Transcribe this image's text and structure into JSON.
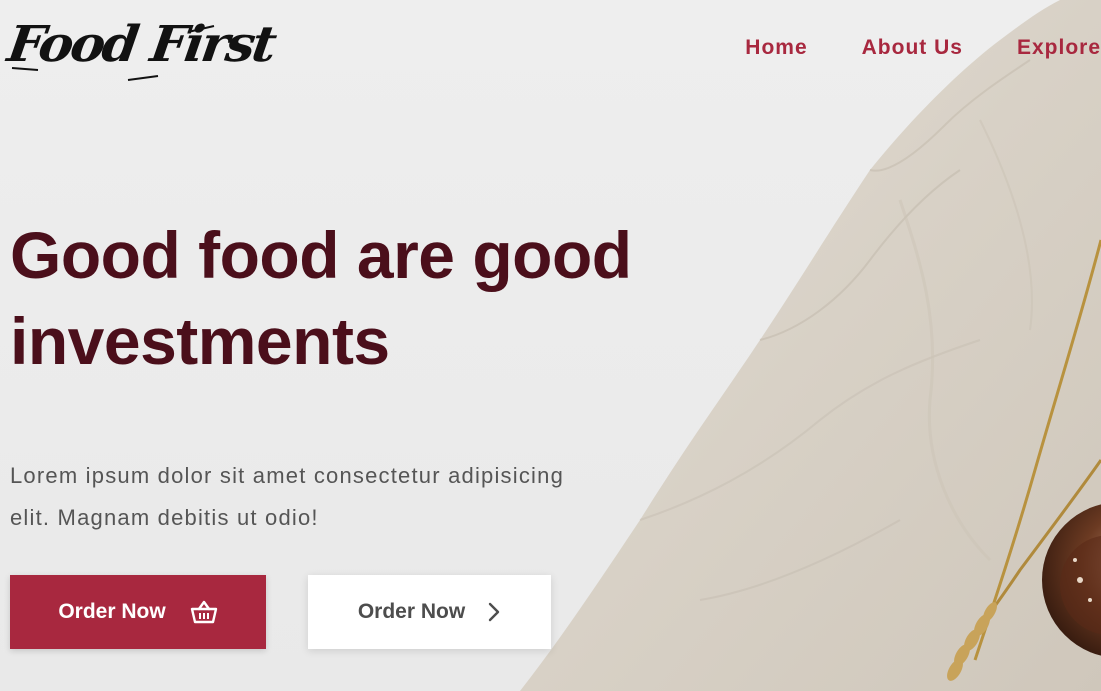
{
  "brand": {
    "logo_text": "Food First"
  },
  "nav": {
    "items": [
      {
        "label": "Home"
      },
      {
        "label": "About Us"
      },
      {
        "label": "Explore"
      }
    ]
  },
  "hero": {
    "title_line1": "Good food are good",
    "title_line2": "investments",
    "description_line1": "Lorem ipsum dolor sit amet consectetur adipisicing",
    "description_line2": "elit. Magnam debitis ut odio!",
    "primary_button": {
      "label": "Order Now",
      "icon": "basket-icon"
    },
    "secondary_button": {
      "label": "Order Now",
      "icon": "chevron-right-icon"
    }
  },
  "colors": {
    "accent": "#a8283f",
    "title": "#4b0f1b",
    "text": "#555555",
    "background": "#ececec",
    "cloth": "#d9d3c8"
  }
}
